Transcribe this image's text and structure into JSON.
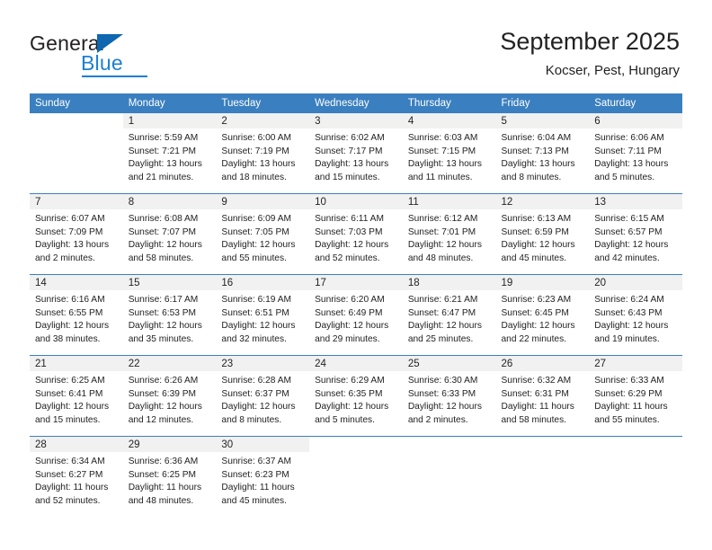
{
  "brand": {
    "name_top": "General",
    "name_bottom": "Blue",
    "triangle_color": "#0e67b0",
    "blue_color": "#1b7fd4"
  },
  "header": {
    "title": "September 2025",
    "subtitle": "Kocser, Pest, Hungary"
  },
  "theme": {
    "header_bg": "#3a7fbf",
    "header_text": "#ffffff",
    "daynum_bg": "#f1f1f1",
    "row_divider": "#3a7fbf"
  },
  "weekday_headers": [
    "Sunday",
    "Monday",
    "Tuesday",
    "Wednesday",
    "Thursday",
    "Friday",
    "Saturday"
  ],
  "weeks": [
    [
      {
        "day": "",
        "blank": true,
        "empty": false,
        "sunrise": "",
        "sunset": "",
        "daylight1": "",
        "daylight2": ""
      },
      {
        "day": "1",
        "sunrise": "Sunrise: 5:59 AM",
        "sunset": "Sunset: 7:21 PM",
        "daylight1": "Daylight: 13 hours",
        "daylight2": "and 21 minutes."
      },
      {
        "day": "2",
        "sunrise": "Sunrise: 6:00 AM",
        "sunset": "Sunset: 7:19 PM",
        "daylight1": "Daylight: 13 hours",
        "daylight2": "and 18 minutes."
      },
      {
        "day": "3",
        "sunrise": "Sunrise: 6:02 AM",
        "sunset": "Sunset: 7:17 PM",
        "daylight1": "Daylight: 13 hours",
        "daylight2": "and 15 minutes."
      },
      {
        "day": "4",
        "sunrise": "Sunrise: 6:03 AM",
        "sunset": "Sunset: 7:15 PM",
        "daylight1": "Daylight: 13 hours",
        "daylight2": "and 11 minutes."
      },
      {
        "day": "5",
        "sunrise": "Sunrise: 6:04 AM",
        "sunset": "Sunset: 7:13 PM",
        "daylight1": "Daylight: 13 hours",
        "daylight2": "and 8 minutes."
      },
      {
        "day": "6",
        "sunrise": "Sunrise: 6:06 AM",
        "sunset": "Sunset: 7:11 PM",
        "daylight1": "Daylight: 13 hours",
        "daylight2": "and 5 minutes."
      }
    ],
    [
      {
        "day": "7",
        "sunrise": "Sunrise: 6:07 AM",
        "sunset": "Sunset: 7:09 PM",
        "daylight1": "Daylight: 13 hours",
        "daylight2": "and 2 minutes."
      },
      {
        "day": "8",
        "sunrise": "Sunrise: 6:08 AM",
        "sunset": "Sunset: 7:07 PM",
        "daylight1": "Daylight: 12 hours",
        "daylight2": "and 58 minutes."
      },
      {
        "day": "9",
        "sunrise": "Sunrise: 6:09 AM",
        "sunset": "Sunset: 7:05 PM",
        "daylight1": "Daylight: 12 hours",
        "daylight2": "and 55 minutes."
      },
      {
        "day": "10",
        "sunrise": "Sunrise: 6:11 AM",
        "sunset": "Sunset: 7:03 PM",
        "daylight1": "Daylight: 12 hours",
        "daylight2": "and 52 minutes."
      },
      {
        "day": "11",
        "sunrise": "Sunrise: 6:12 AM",
        "sunset": "Sunset: 7:01 PM",
        "daylight1": "Daylight: 12 hours",
        "daylight2": "and 48 minutes."
      },
      {
        "day": "12",
        "sunrise": "Sunrise: 6:13 AM",
        "sunset": "Sunset: 6:59 PM",
        "daylight1": "Daylight: 12 hours",
        "daylight2": "and 45 minutes."
      },
      {
        "day": "13",
        "sunrise": "Sunrise: 6:15 AM",
        "sunset": "Sunset: 6:57 PM",
        "daylight1": "Daylight: 12 hours",
        "daylight2": "and 42 minutes."
      }
    ],
    [
      {
        "day": "14",
        "sunrise": "Sunrise: 6:16 AM",
        "sunset": "Sunset: 6:55 PM",
        "daylight1": "Daylight: 12 hours",
        "daylight2": "and 38 minutes."
      },
      {
        "day": "15",
        "sunrise": "Sunrise: 6:17 AM",
        "sunset": "Sunset: 6:53 PM",
        "daylight1": "Daylight: 12 hours",
        "daylight2": "and 35 minutes."
      },
      {
        "day": "16",
        "sunrise": "Sunrise: 6:19 AM",
        "sunset": "Sunset: 6:51 PM",
        "daylight1": "Daylight: 12 hours",
        "daylight2": "and 32 minutes."
      },
      {
        "day": "17",
        "sunrise": "Sunrise: 6:20 AM",
        "sunset": "Sunset: 6:49 PM",
        "daylight1": "Daylight: 12 hours",
        "daylight2": "and 29 minutes."
      },
      {
        "day": "18",
        "sunrise": "Sunrise: 6:21 AM",
        "sunset": "Sunset: 6:47 PM",
        "daylight1": "Daylight: 12 hours",
        "daylight2": "and 25 minutes."
      },
      {
        "day": "19",
        "sunrise": "Sunrise: 6:23 AM",
        "sunset": "Sunset: 6:45 PM",
        "daylight1": "Daylight: 12 hours",
        "daylight2": "and 22 minutes."
      },
      {
        "day": "20",
        "sunrise": "Sunrise: 6:24 AM",
        "sunset": "Sunset: 6:43 PM",
        "daylight1": "Daylight: 12 hours",
        "daylight2": "and 19 minutes."
      }
    ],
    [
      {
        "day": "21",
        "sunrise": "Sunrise: 6:25 AM",
        "sunset": "Sunset: 6:41 PM",
        "daylight1": "Daylight: 12 hours",
        "daylight2": "and 15 minutes."
      },
      {
        "day": "22",
        "sunrise": "Sunrise: 6:26 AM",
        "sunset": "Sunset: 6:39 PM",
        "daylight1": "Daylight: 12 hours",
        "daylight2": "and 12 minutes."
      },
      {
        "day": "23",
        "sunrise": "Sunrise: 6:28 AM",
        "sunset": "Sunset: 6:37 PM",
        "daylight1": "Daylight: 12 hours",
        "daylight2": "and 8 minutes."
      },
      {
        "day": "24",
        "sunrise": "Sunrise: 6:29 AM",
        "sunset": "Sunset: 6:35 PM",
        "daylight1": "Daylight: 12 hours",
        "daylight2": "and 5 minutes."
      },
      {
        "day": "25",
        "sunrise": "Sunrise: 6:30 AM",
        "sunset": "Sunset: 6:33 PM",
        "daylight1": "Daylight: 12 hours",
        "daylight2": "and 2 minutes."
      },
      {
        "day": "26",
        "sunrise": "Sunrise: 6:32 AM",
        "sunset": "Sunset: 6:31 PM",
        "daylight1": "Daylight: 11 hours",
        "daylight2": "and 58 minutes."
      },
      {
        "day": "27",
        "sunrise": "Sunrise: 6:33 AM",
        "sunset": "Sunset: 6:29 PM",
        "daylight1": "Daylight: 11 hours",
        "daylight2": "and 55 minutes."
      }
    ],
    [
      {
        "day": "28",
        "sunrise": "Sunrise: 6:34 AM",
        "sunset": "Sunset: 6:27 PM",
        "daylight1": "Daylight: 11 hours",
        "daylight2": "and 52 minutes."
      },
      {
        "day": "29",
        "sunrise": "Sunrise: 6:36 AM",
        "sunset": "Sunset: 6:25 PM",
        "daylight1": "Daylight: 11 hours",
        "daylight2": "and 48 minutes."
      },
      {
        "day": "30",
        "sunrise": "Sunrise: 6:37 AM",
        "sunset": "Sunset: 6:23 PM",
        "daylight1": "Daylight: 11 hours",
        "daylight2": "and 45 minutes."
      },
      {
        "day": "",
        "blank": true,
        "sunrise": "",
        "sunset": "",
        "daylight1": "",
        "daylight2": ""
      },
      {
        "day": "",
        "blank": true,
        "sunrise": "",
        "sunset": "",
        "daylight1": "",
        "daylight2": ""
      },
      {
        "day": "",
        "blank": true,
        "sunrise": "",
        "sunset": "",
        "daylight1": "",
        "daylight2": ""
      },
      {
        "day": "",
        "blank": true,
        "sunrise": "",
        "sunset": "",
        "daylight1": "",
        "daylight2": ""
      }
    ]
  ]
}
